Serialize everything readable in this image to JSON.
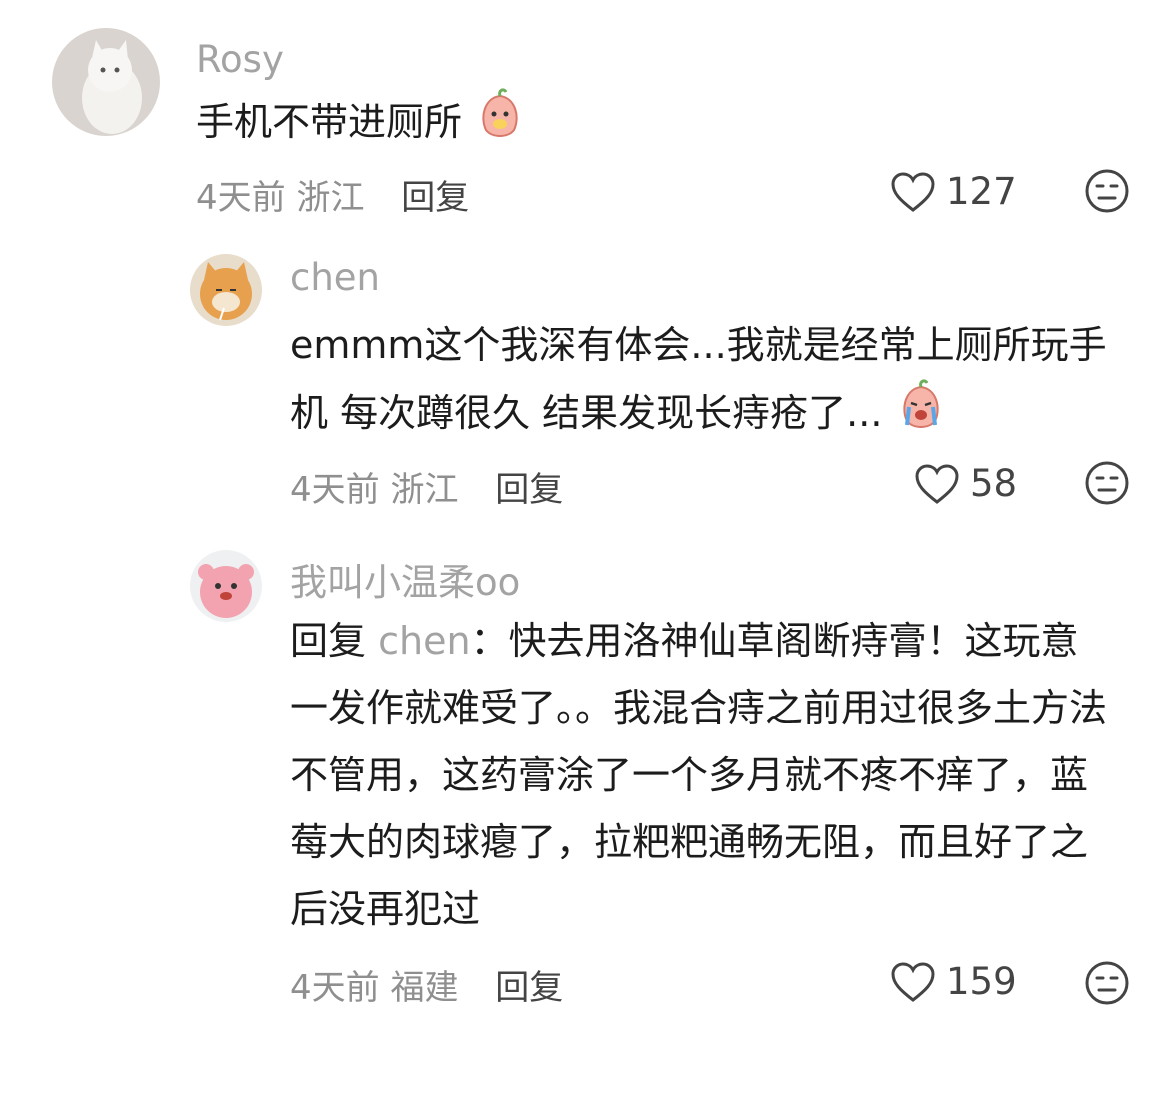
{
  "comments": [
    {
      "username": "Rosy",
      "text": "手机不带进厕所",
      "emoji": "peach-emoji",
      "meta": {
        "time": "4天前",
        "location": "浙江",
        "reply_label": "回复"
      },
      "likes": "127"
    },
    {
      "username": "chen",
      "text": "emmm这个我深有体会...我就是经常上厕所玩手机 每次蹲很久 结果发现长痔疮了...",
      "emoji": "crying-peach-emoji",
      "meta": {
        "time": "4天前",
        "location": "浙江",
        "reply_label": "回复"
      },
      "likes": "58"
    },
    {
      "username": "我叫小温柔oo",
      "reply_prefix": "回复 ",
      "reply_target": "chen",
      "text": "：快去用洛神仙草阁断痔膏！这玩意一发作就难受了。。我混合痔之前用过很多土方法不管用，这药膏涂了一个多月就不疼不痒了，蓝莓大的肉球瘪了，拉粑粑通畅无阻，而且好了之后没再犯过",
      "meta": {
        "time": "4天前",
        "location": "福建",
        "reply_label": "回复"
      },
      "likes": "159"
    }
  ]
}
